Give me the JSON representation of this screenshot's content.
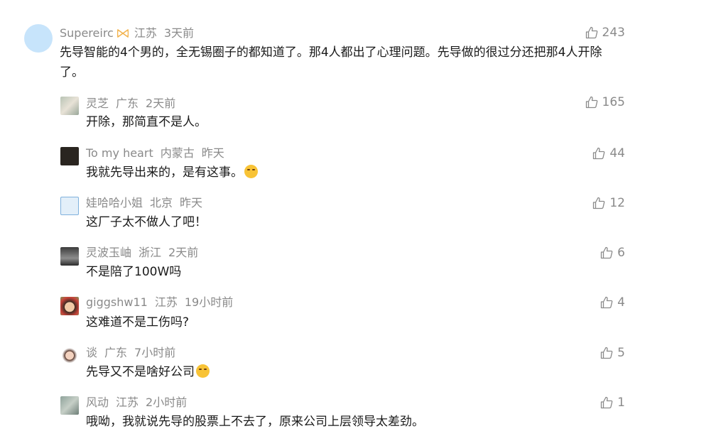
{
  "comments": [
    {
      "user": "Supereirc",
      "region": "江苏",
      "time": "3天前",
      "likes": "243",
      "text": "先导智能的4个男的，全无锡圈子的都知道了。那4人都出了心理问题。先导做的很过分还把那4人开除了。"
    },
    {
      "user": "灵芝",
      "region": "广东",
      "time": "2天前",
      "likes": "165",
      "text": "开除，那简直不是人。"
    },
    {
      "user": "To my heart",
      "region": "内蒙古",
      "time": "昨天",
      "likes": "44",
      "text": "我就先导出来的，是有这事。"
    },
    {
      "user": "娃哈哈小姐",
      "region": "北京",
      "time": "昨天",
      "likes": "12",
      "text": "这厂子太不做人了吧！"
    },
    {
      "user": "灵波玉岫",
      "region": "浙江",
      "time": "2天前",
      "likes": "6",
      "text": "不是陪了100W吗"
    },
    {
      "user": "giggshw11",
      "region": "江苏",
      "time": "19小时前",
      "likes": "4",
      "text": "这难道不是工伤吗?"
    },
    {
      "user": "谈",
      "region": "广东",
      "time": "7小时前",
      "likes": "5",
      "text": "先导又不是啥好公司"
    },
    {
      "user": "风动",
      "region": "江苏",
      "time": "2小时前",
      "likes": "1",
      "text": "哦呦，我就说先导的股票上不去了，原来公司上层领导太差劲。"
    }
  ],
  "colors": {
    "meta": "#8a8a8a",
    "text": "#1a1a1a",
    "avatar_main": "#c7e4fb"
  },
  "icons": {
    "like": "thumbs-up-icon",
    "badge": "bow-badge-icon",
    "emoji": "face-emoji-icon"
  }
}
